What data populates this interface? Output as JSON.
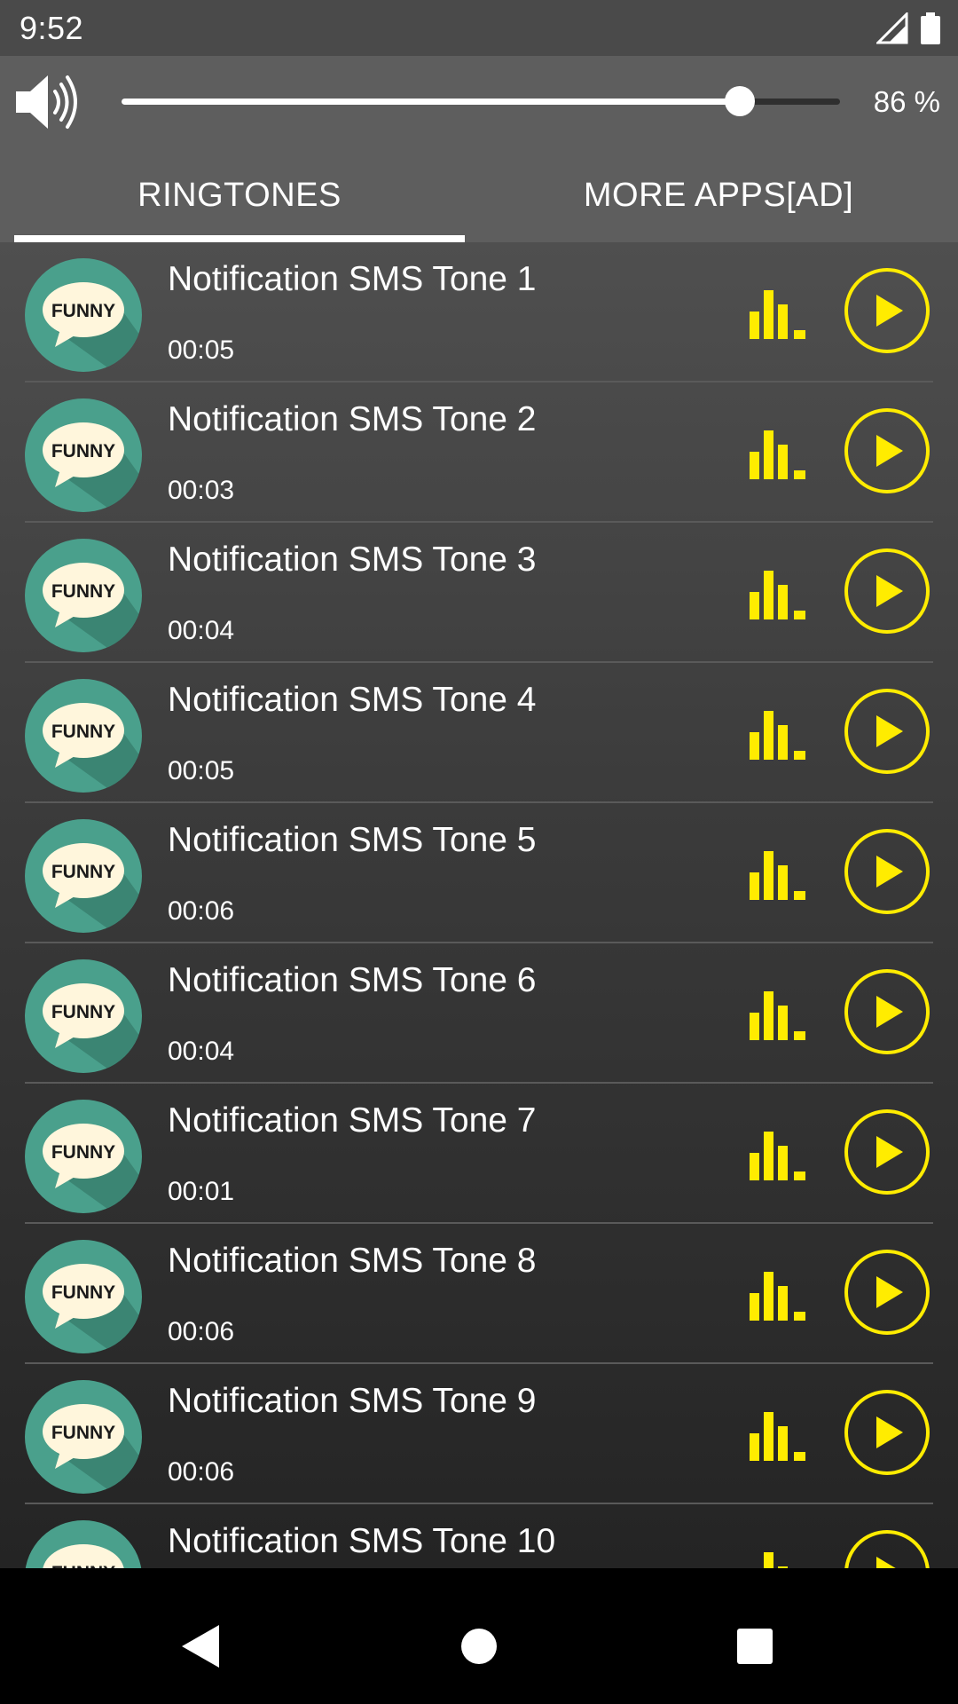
{
  "status_bar": {
    "time": "9:52"
  },
  "volume": {
    "level_percent": 86,
    "label": "86 %"
  },
  "tabs": [
    {
      "label": "RINGTONES",
      "selected": true
    },
    {
      "label": "MORE APPS[AD]",
      "selected": false
    }
  ],
  "ringtones": [
    {
      "title": "Notification SMS Tone 1",
      "duration": "00:05",
      "badge": "FUNNY"
    },
    {
      "title": "Notification SMS Tone 2",
      "duration": "00:03",
      "badge": "FUNNY"
    },
    {
      "title": "Notification SMS Tone 3",
      "duration": "00:04",
      "badge": "FUNNY"
    },
    {
      "title": "Notification SMS Tone 4",
      "duration": "00:05",
      "badge": "FUNNY"
    },
    {
      "title": "Notification SMS Tone 5",
      "duration": "00:06",
      "badge": "FUNNY"
    },
    {
      "title": "Notification SMS Tone 6",
      "duration": "00:04",
      "badge": "FUNNY"
    },
    {
      "title": "Notification SMS Tone 7",
      "duration": "00:01",
      "badge": "FUNNY"
    },
    {
      "title": "Notification SMS Tone 8",
      "duration": "00:06",
      "badge": "FUNNY"
    },
    {
      "title": "Notification SMS Tone 9",
      "duration": "00:06",
      "badge": "FUNNY"
    },
    {
      "title": "Notification SMS Tone 10",
      "duration": "",
      "badge": "FUNNY"
    }
  ],
  "icons": {
    "volume": "speaker-icon",
    "equalizer": "equalizer-icon",
    "play": "play-icon",
    "signal": "signal-icon",
    "battery": "battery-icon",
    "nav_back": "back-icon",
    "nav_home": "home-icon",
    "nav_recents": "recents-icon"
  },
  "colors": {
    "accent": "#ffec00",
    "avatar_bg": "#4aa08c",
    "bubble": "#fff6dc"
  }
}
